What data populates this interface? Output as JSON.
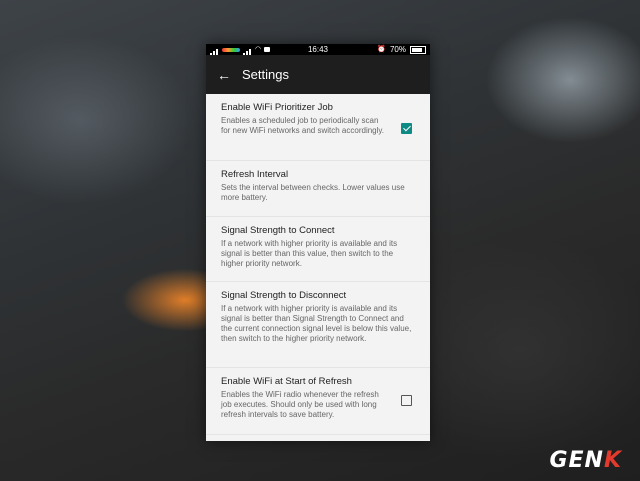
{
  "status_bar": {
    "time": "16:43",
    "battery": "70%"
  },
  "toolbar": {
    "back_icon": "←",
    "title": "Settings"
  },
  "settings": [
    {
      "title": "Enable WiFi Prioritizer Job",
      "summary": "Enables a scheduled job to periodically scan for new WiFi networks and switch accordingly.",
      "checkbox": true,
      "checked": true
    },
    {
      "title": "Refresh Interval",
      "summary": "Sets the interval between checks. Lower values use more battery."
    },
    {
      "title": "Signal Strength to Connect",
      "summary": "If a network with higher priority is available and its signal is better than this value, then switch to the higher priority network."
    },
    {
      "title": "Signal Strength to Disconnect",
      "summary": "If a network with higher priority is available and its signal is better than Signal Strength to Connect and the current connection signal level is below this value, then switch to the higher priority network."
    },
    {
      "title": "Enable WiFi at Start of Refresh",
      "summary": "Enables the WiFi radio whenever the refresh job executes. Should only be used with long refresh intervals to save battery.",
      "checkbox": true,
      "checked": false
    }
  ],
  "watermark": {
    "main": "GEN",
    "accent": "K"
  },
  "colors": {
    "accent": "#0e8a84",
    "toolbar": "#1e1e1e"
  }
}
